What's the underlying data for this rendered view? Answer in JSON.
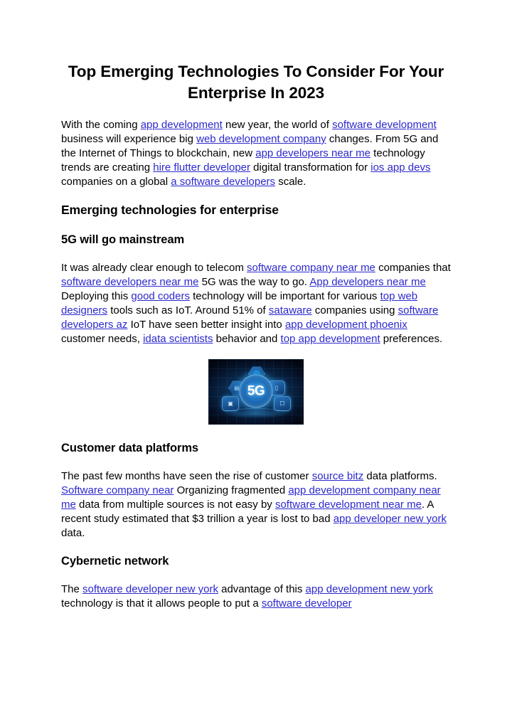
{
  "document": {
    "title": "Top Emerging Technologies To Consider For Your Enterprise In 2023",
    "link_color": "#2d29cc",
    "text_color": "#000000",
    "background_color": "#ffffff"
  },
  "intro": {
    "t1": "With the coming ",
    "l1": "app development",
    "t2": " new year, the world of ",
    "l2": "software development",
    "t3": " business will experience big ",
    "l3": "web development company",
    "t4": " changes. From 5G and the Internet of Things to blockchain, new ",
    "l4": "app developers near me",
    "t5": " technology trends are creating ",
    "l5": "hire flutter developer",
    "t6": " digital transformation for ",
    "l6": "ios app devs",
    "t7": " companies on a global ",
    "l7": "a software developers",
    "t8": " scale."
  },
  "section_enterprise": {
    "heading": "Emerging technologies for enterprise"
  },
  "section_5g": {
    "heading": "5G will go mainstream",
    "t1": "It was already clear enough to telecom ",
    "l1": "software company near me",
    "t2": " companies that ",
    "l2": "software developers near me",
    "t3": " 5G was the way to go. ",
    "l3": "App developers near me",
    "t4": " Deploying this ",
    "l4": "good coders",
    "t5": " technology will be important for various ",
    "l5": "top web designers",
    "t6": " tools such as IoT. Around 51% of ",
    "l6": "sataware",
    "t7": " companies using ",
    "l7": "software developers az",
    "t8": " IoT have seen better insight into ",
    "l8": "app development phoenix",
    "t9": " customer needs, ",
    "l9": "idata scientists",
    "t10": " behavior and ",
    "l10": "top app development",
    "t11": " preferences.",
    "figure": {
      "alt": "5G network technology illustration",
      "core_label": "5G",
      "nodes": [
        "globe-icon",
        "server-icon",
        "laptop-icon",
        "devices-icon",
        "chat-icon"
      ]
    }
  },
  "section_cdp": {
    "heading": "Customer data platforms",
    "t1": "The past few months have seen the rise of customer ",
    "l1": "source bitz",
    "t2": " data platforms. ",
    "l2": "Software company near",
    "t3": " Organizing fragmented ",
    "l3": "app development company near me",
    "t4": " data from multiple sources is not easy by ",
    "l4": "software development near me",
    "t5": ". A recent study estimated that $3 trillion a year is lost to bad ",
    "l5": "app developer new york",
    "t6": " data."
  },
  "section_cyber": {
    "heading": "Cybernetic network",
    "t1": "The ",
    "l1": "software developer new york",
    "t2": " advantage of this ",
    "l2": "app development new york",
    "t3": " technology is that it allows people to put a ",
    "l3": "software developer"
  }
}
